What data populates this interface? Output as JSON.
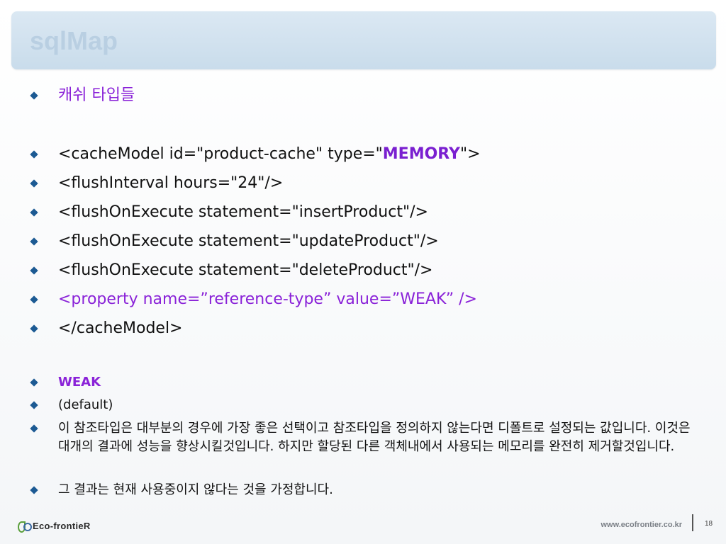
{
  "slide": {
    "title": "sqlMap",
    "heading": "캐쉬 타입들",
    "code_lines": [
      {
        "prefix": "<cacheModel id=\"product-cache\" type=\"",
        "highlight": "MEMORY",
        "suffix": "\">"
      },
      {
        "text": "<flushInterval hours=\"24\"/>"
      },
      {
        "text": "<flushOnExecute statement=\"insertProduct\"/>"
      },
      {
        "text": "<flushOnExecute statement=\"updateProduct\"/>"
      },
      {
        "text": "<flushOnExecute statement=\"deleteProduct\"/>"
      },
      {
        "text": "<property name=”reference-type” value=”WEAK” />"
      },
      {
        "text": "</cacheModel>"
      }
    ],
    "notes": [
      {
        "text": "WEAK"
      },
      {
        "text": "(default)"
      },
      {
        "text": "이 참조타입은 대부분의 경우에 가장 좋은 선택이고 참조타입을 정의하지 않는다면 디폴트로 설정되는 값입니다. 이것은 대개의 결과에 성능을 향상시킬것입니다. 하지만 할당된 다른 객체내에서 사용되는 메모리를 완전히 제거할것입니다."
      },
      {
        "text": "그 결과는 현재 사용중이지 않다는 것을 가정합니다."
      }
    ]
  },
  "footer": {
    "logo": "Eco-frontieR",
    "url": "www.ecofrontier.co.kr",
    "page_number": "18"
  },
  "colors": {
    "bullet": "#1c5a93",
    "accent_purple": "#8a22d8",
    "title_bar": "#d3e3f0"
  }
}
